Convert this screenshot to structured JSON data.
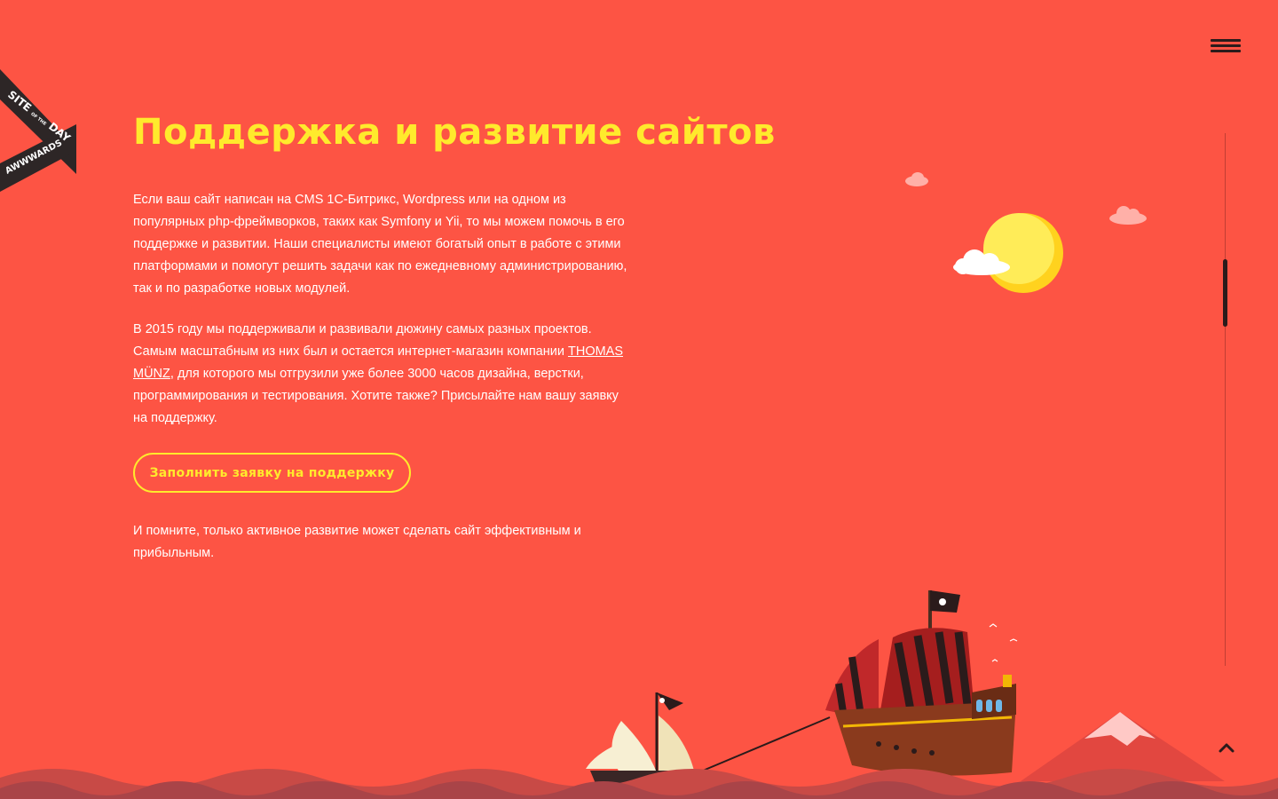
{
  "badge": {
    "line1": "SITE",
    "line1_small": "OF THE",
    "line2": "DAY",
    "brand": "AWWWARDS"
  },
  "heading": "Поддержка и развитие сайтов",
  "para1": "Если ваш сайт написан на CMS 1С-Битрикс, Wordpress или на одном из популярных php-фреймворков, таких как Symfony и Yii, то мы можем помочь в его поддержке и развитии. Наши специалисты имеют богатый опыт в работе с этими платформами и помогут решить задачи как по ежедневному администрированию, так и по разработке новых модулей.",
  "para2": {
    "before": "В 2015 году мы поддерживали и развивали дюжину самых разных проектов. Самым масштабным из них был и остается интернет-магазин компании ",
    "link": "THOMAS MÜNZ",
    "after": ", для которого мы отгрузили уже более 3000 часов дизайна, верстки, программирования и тестирования. Хотите также? Присылайте нам вашу заявку на поддержку."
  },
  "cta_label": "Заполнить заявку на поддержку",
  "para3": "И помните, только активное развитие может сделать сайт эффективным и прибыльным.",
  "icons": {
    "menu": "hamburger-menu-icon",
    "scroll_top": "chevron-up-icon"
  },
  "colors": {
    "background": "#fd5444",
    "accent": "#ffea2c",
    "text": "#ffffff",
    "dark": "#2b1b1b"
  }
}
